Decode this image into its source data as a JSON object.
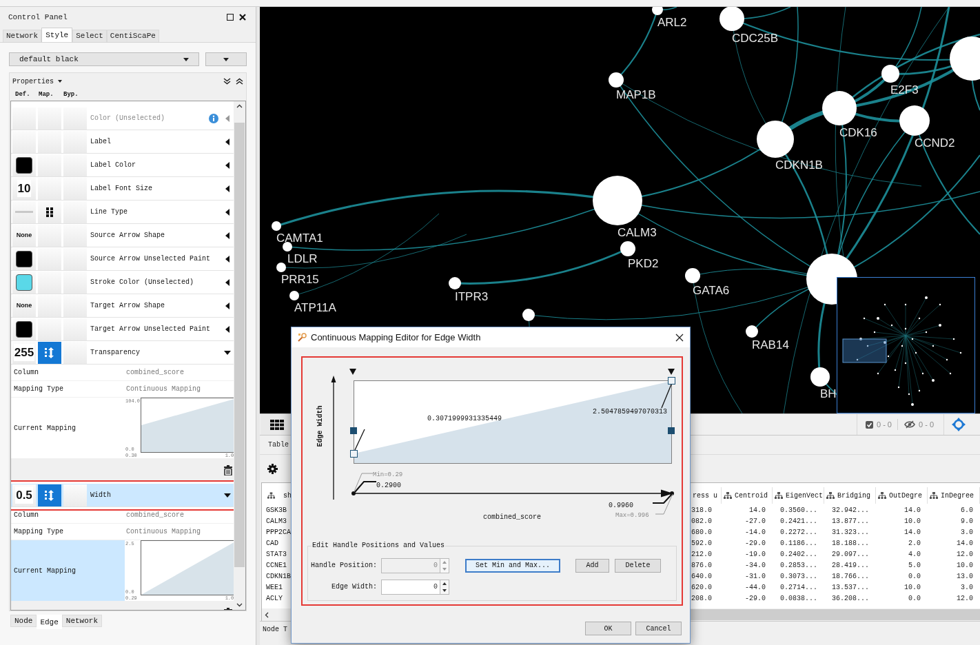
{
  "control_panel": {
    "title": "Control Panel",
    "tabs": [
      {
        "label": "Network",
        "selected": false
      },
      {
        "label": "Style",
        "selected": true
      },
      {
        "label": "Select",
        "selected": false
      },
      {
        "label": "CentiScaPe",
        "selected": false
      }
    ],
    "style_name": "default black",
    "properties_label": "Properties",
    "column_headers": [
      "Def.",
      "Map.",
      "Byp."
    ],
    "properties": [
      {
        "name": "Color (Unselected)",
        "def": {
          "kind": "blank"
        },
        "map": {
          "kind": "none"
        },
        "disabled": true,
        "info": true,
        "expanded": false,
        "selected": false,
        "highlighted": false
      },
      {
        "name": "Label",
        "def": {
          "kind": "blank"
        },
        "map": {
          "kind": "none"
        },
        "disabled": false,
        "info": false,
        "expanded": false,
        "selected": false,
        "highlighted": false
      },
      {
        "name": "Label Color",
        "def": {
          "kind": "swatch",
          "color": "#000000"
        },
        "map": {
          "kind": "none"
        },
        "disabled": false,
        "info": false,
        "expanded": false,
        "selected": false,
        "highlighted": false
      },
      {
        "name": "Label Font Size",
        "def": {
          "kind": "number",
          "text": "10"
        },
        "map": {
          "kind": "none"
        },
        "disabled": false,
        "info": false,
        "expanded": false,
        "selected": false,
        "highlighted": false
      },
      {
        "name": "Line Type",
        "def": {
          "kind": "line"
        },
        "map": {
          "kind": "passthrough"
        },
        "disabled": false,
        "info": false,
        "expanded": false,
        "selected": false,
        "highlighted": false
      },
      {
        "name": "Source Arrow Shape",
        "def": {
          "kind": "word",
          "text": "None"
        },
        "map": {
          "kind": "none"
        },
        "disabled": false,
        "info": false,
        "expanded": false,
        "selected": false,
        "highlighted": false
      },
      {
        "name": "Source Arrow Unselected Paint",
        "def": {
          "kind": "swatch",
          "color": "#000000"
        },
        "map": {
          "kind": "none"
        },
        "disabled": false,
        "info": false,
        "expanded": false,
        "selected": false,
        "highlighted": false
      },
      {
        "name": "Stroke Color (Unselected)",
        "def": {
          "kind": "swatch",
          "color": "#5ad8e8"
        },
        "map": {
          "kind": "none"
        },
        "disabled": false,
        "info": false,
        "expanded": false,
        "selected": false,
        "highlighted": false
      },
      {
        "name": "Target Arrow Shape",
        "def": {
          "kind": "word",
          "text": "None"
        },
        "map": {
          "kind": "none"
        },
        "disabled": false,
        "info": false,
        "expanded": false,
        "selected": false,
        "highlighted": false
      },
      {
        "name": "Target Arrow Unselected Paint",
        "def": {
          "kind": "swatch",
          "color": "#000000"
        },
        "map": {
          "kind": "none"
        },
        "disabled": false,
        "info": false,
        "expanded": false,
        "selected": false,
        "highlighted": false
      },
      {
        "name": "Transparency",
        "def": {
          "kind": "number",
          "text": "255"
        },
        "map": {
          "kind": "continuous"
        },
        "disabled": false,
        "info": false,
        "expanded": true,
        "selected": false,
        "highlighted": false,
        "details": {
          "rows": [
            {
              "label": "Column",
              "value": "combined_score"
            },
            {
              "label": "Mapping Type",
              "value": "Continuous Mapping"
            }
          ],
          "current_mapping_label": "Current Mapping",
          "current_mapping_selected": false,
          "y_max": "104.0",
          "y_min": "0.0",
          "x_min": "0.30",
          "x_max": "1.0"
        }
      },
      {
        "name": "Width",
        "def": {
          "kind": "number",
          "text": "0.5"
        },
        "map": {
          "kind": "continuous"
        },
        "disabled": false,
        "info": false,
        "expanded": true,
        "selected": true,
        "highlighted": true,
        "details": {
          "rows": [
            {
              "label": "Column",
              "value": "combined_score"
            },
            {
              "label": "Mapping Type",
              "value": "Continuous Mapping"
            }
          ],
          "current_mapping_label": "Current Mapping",
          "current_mapping_selected": true,
          "y_max": "2.5",
          "y_min": "0.0",
          "x_min": "0.29",
          "x_max": "1.0"
        }
      }
    ],
    "bottom_tabs": [
      {
        "label": "Node",
        "selected": false
      },
      {
        "label": "Edge",
        "selected": true
      },
      {
        "label": "Network",
        "selected": false
      }
    ]
  },
  "network": {
    "nodes": [
      {
        "label": "ARL2"
      },
      {
        "label": "CDC25B"
      },
      {
        "label": "MAP1B"
      },
      {
        "label": "E2F3"
      },
      {
        "label": "CDK16"
      },
      {
        "label": "CCND2"
      },
      {
        "label": "CDKN1B"
      },
      {
        "label": "CALM3"
      },
      {
        "label": "PKD2"
      },
      {
        "label": "CAMTA1"
      },
      {
        "label": "LDLR"
      },
      {
        "label": "PRR15"
      },
      {
        "label": "ATP11A"
      },
      {
        "label": "ITPR3"
      },
      {
        "label": "GATA6"
      },
      {
        "label": "RAB14"
      },
      {
        "label": "BH"
      }
    ]
  },
  "status_bar": {
    "selected_count": "0 - 0",
    "hidden_count": "0 - 0"
  },
  "table_panel": {
    "tab": "Table",
    "left_column": {
      "header": "sh",
      "cells": [
        "GSK3B",
        "CALM3",
        "PPP2CA",
        "CAD",
        "STAT3",
        "CCNE1",
        "CDKN1B",
        "WEE1",
        "ACLY"
      ]
    },
    "right_columns": [
      {
        "header": "ress u",
        "icon": false,
        "cells": [
          "318.0",
          "082.0",
          "680.0",
          "592.0",
          "212.0",
          "876.0",
          "640.0",
          "620.0",
          "208.0"
        ]
      },
      {
        "header": "Centroid",
        "icon": true,
        "cells": [
          "14.0",
          "-27.0",
          "-14.0",
          "-29.0",
          "-19.0",
          "-34.0",
          "-31.0",
          "-44.0",
          "-29.0"
        ]
      },
      {
        "header": "EigenVect",
        "icon": true,
        "cells": [
          "0.3560...",
          "0.2421...",
          "0.2272...",
          "0.1186...",
          "0.2402...",
          "0.2853...",
          "0.3073...",
          "0.2714...",
          "0.0838..."
        ]
      },
      {
        "header": "Bridging",
        "icon": true,
        "cells": [
          "32.942...",
          "13.877...",
          "31.323...",
          "18.188...",
          "29.097...",
          "28.419...",
          "18.766...",
          "13.537...",
          "36.208..."
        ]
      },
      {
        "header": "OutDegre",
        "icon": true,
        "cells": [
          "14.0",
          "10.0",
          "14.0",
          "2.0",
          "4.0",
          "5.0",
          "0.0",
          "10.0",
          "0.0"
        ]
      },
      {
        "header": "InDegree",
        "icon": true,
        "cells": [
          "6.0",
          "9.0",
          "3.0",
          "14.0",
          "12.0",
          "10.0",
          "13.0",
          "3.0",
          "12.0"
        ]
      }
    ],
    "bottom_tab": "Node T"
  },
  "mapping_editor": {
    "title": "Continuous Mapping Editor for Edge Width",
    "highlighted": true,
    "y_axis_label": "Edge Width",
    "x_axis_label": "combined_score",
    "handle_values": [
      "0.3071999931335449",
      "2.5047859497070313"
    ],
    "min_label": "Min=0.29",
    "min_value": "0.2900",
    "max_value": "0.9960",
    "max_label": "Max=0.996",
    "group_title": "Edit Handle Positions and Values",
    "fields": [
      {
        "label": "Handle Position:",
        "value": "0",
        "disabled": true
      },
      {
        "label": "Edge Width:",
        "value": "0",
        "disabled": false
      }
    ],
    "buttons": [
      {
        "label": "Set Min and Max...",
        "focused": true
      },
      {
        "label": "Add",
        "focused": false
      },
      {
        "label": "Delete",
        "focused": false
      }
    ],
    "footer_buttons": [
      "OK",
      "Cancel"
    ]
  }
}
